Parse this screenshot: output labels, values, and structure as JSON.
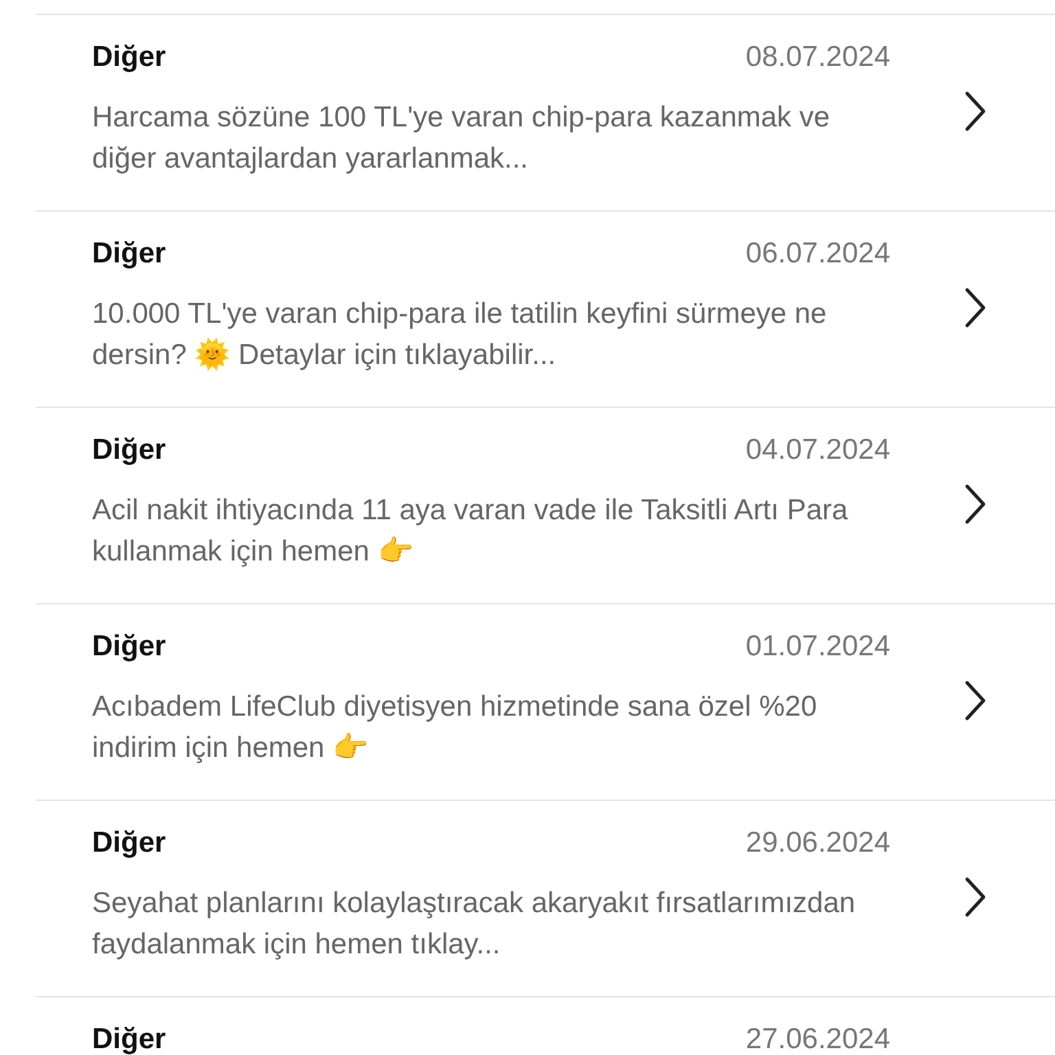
{
  "messages": [
    {
      "category": "Diğer",
      "date": "08.07.2024",
      "text": "Harcama sözüne 100 TL'ye varan chip-para kazanmak ve diğer avantajlardan yararlanmak..."
    },
    {
      "category": "Diğer",
      "date": "06.07.2024",
      "text": "10.000 TL'ye varan chip-para ile tatilin keyfini sürmeye ne dersin? 🌞 Detaylar için tıklayabilir..."
    },
    {
      "category": "Diğer",
      "date": "04.07.2024",
      "text": "Acil nakit ihtiyacında 11 aya varan vade ile Taksitli Artı Para kullanmak için hemen 👉"
    },
    {
      "category": "Diğer",
      "date": "01.07.2024",
      "text": "Acıbadem LifeClub diyetisyen hizmetinde sana özel %20 indirim için hemen 👉"
    },
    {
      "category": "Diğer",
      "date": "29.06.2024",
      "text": "Seyahat planlarını kolaylaştıracak akaryakıt fırsatlarımızdan faydalanmak için hemen tıklay..."
    },
    {
      "category": "Diğer",
      "date": "27.06.2024"
    }
  ]
}
